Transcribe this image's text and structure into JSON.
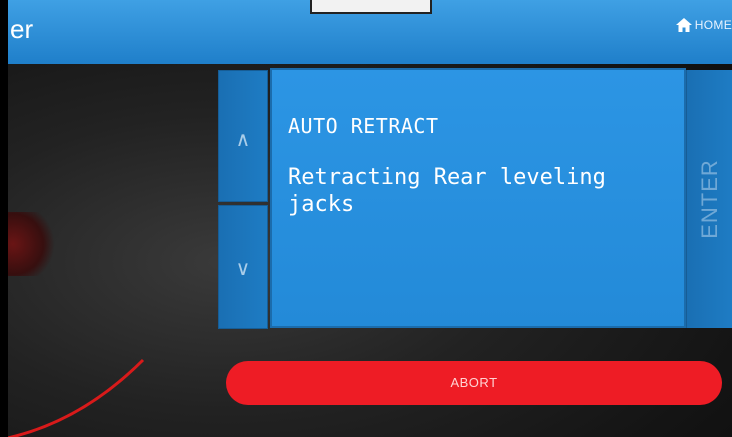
{
  "header": {
    "title": "er",
    "home_label": "HOME"
  },
  "controls": {
    "up_glyph": "∧",
    "down_glyph": "∨",
    "enter_label": "ENTER",
    "abort_label": "ABORT"
  },
  "display": {
    "title": "AUTO RETRACT",
    "message": "Retracting Rear leveling jacks"
  },
  "colors": {
    "header": "#2a8fd8",
    "panel": "#2690e0",
    "abort": "#ee1c25"
  }
}
